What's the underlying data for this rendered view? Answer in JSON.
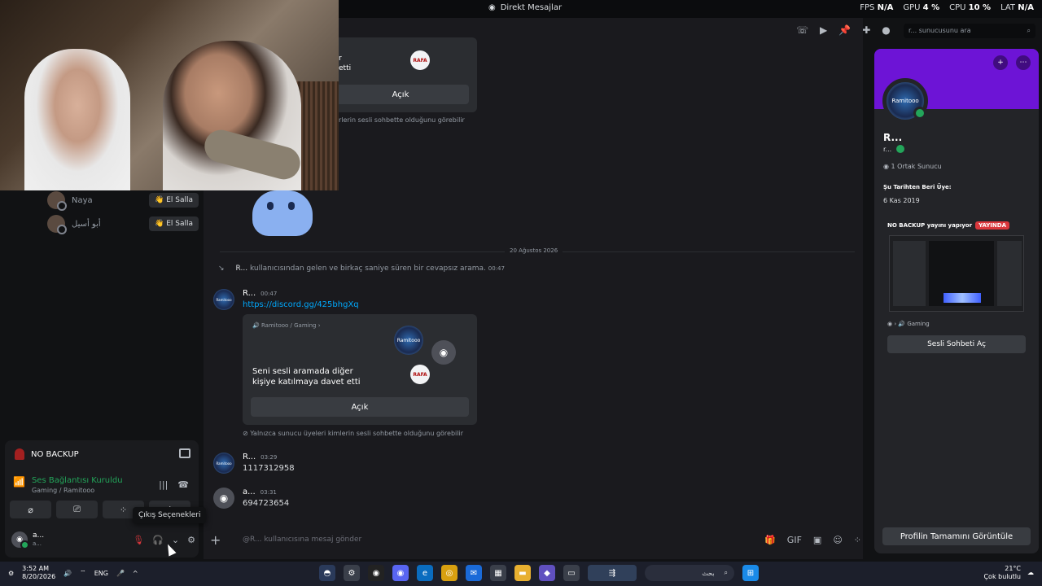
{
  "titlebar": {
    "title": "Direkt Mesajlar",
    "fps_label": "FPS",
    "fps_value": "N/A",
    "gpu_label": "GPU",
    "gpu_value": "4 %",
    "cpu_label": "CPU",
    "cpu_value": "10 %",
    "lat_label": "LAT",
    "lat_value": "N/A"
  },
  "search": {
    "placeholder": "r... sunucusunu ara"
  },
  "friends": [
    {
      "name": "Naya",
      "action": "El Salla"
    },
    {
      "name": "أبو أسيل",
      "action": "El Salla"
    }
  ],
  "embed_top": {
    "partial_text_1": "r",
    "partial_text_2": "etti",
    "join_label": "Açık",
    "note": "rlerin sesli sohbette olduğunu görebilir"
  },
  "date_divider": "20 Ağustos 2026",
  "call_line": {
    "user": "R...",
    "text": "kullanıcısından gelen ve birkaç saniye süren bir cevapsız arama.",
    "time": "00:47"
  },
  "messages": [
    {
      "author": "R...",
      "time": "00:47",
      "body": "https://discord.gg/425bhgXq"
    },
    {
      "author": "R...",
      "time": "03:29",
      "body": "1117312958"
    },
    {
      "author": "a...",
      "time": "03:31",
      "body": "694723654"
    }
  ],
  "embed_main": {
    "header": "Ramitooo / Gaming",
    "message": "Seni sesli aramada diğer kişiye katılmaya davet etti",
    "join_label": "Açık",
    "avatar_label": "Ramitooo",
    "rafa_label": "RAFA",
    "note": "Yalnızca sunucu üyeleri kimlerin sesli sohbette olduğunu görebilir"
  },
  "composer": {
    "placeholder": "@R... kullanıcısına mesaj gönder"
  },
  "voice_panel": {
    "live_title": "NO BACKUP",
    "status": "Ses Bağlantısı Kuruldu",
    "channel": "Gaming / Ramitooo",
    "tooltip": "Çıkış Seçenekleri"
  },
  "current_user": {
    "name": "a...",
    "status": "a..."
  },
  "profile": {
    "name": "R...",
    "sub": "r...",
    "avatar_label": "Ramitooo",
    "mutual": "1 Ortak Sunucu",
    "since_label": "Şu Tarihten Beri Üye:",
    "since_value": "6 Kas 2019",
    "live_text": "NO BACKUP yayını yapıyor",
    "live_badge": "YAYINDA",
    "game": "Gaming",
    "voice_button": "Sesli Sohbeti Aç",
    "full_button": "Profilin Tamamını Görüntüle"
  },
  "taskbar": {
    "time": "3:52 AM",
    "date": "8/20/2026",
    "lang": "ENG",
    "search_text": "بحث",
    "weather_temp": "21°C",
    "weather_desc": "Çok bulutlu"
  },
  "colors": {
    "accent": "#5865f2",
    "online": "#23a55a",
    "live": "#da373c",
    "banner": "#6d14d6",
    "link": "#00a8fc"
  }
}
